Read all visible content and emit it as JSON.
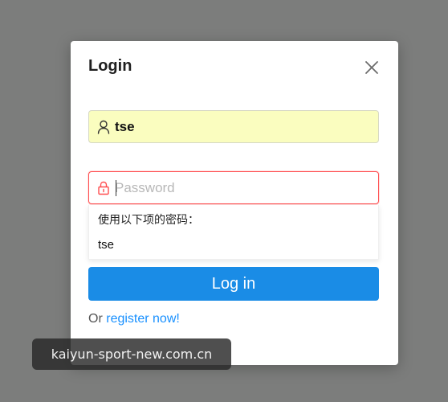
{
  "colors": {
    "backdrop": "#7c7d7c",
    "primary": "#1a8ce6",
    "error_border": "#ff4d4f",
    "autofill_bg": "#fafdbf",
    "link": "#1890ff"
  },
  "modal": {
    "title": "Login",
    "close_icon": "close-icon"
  },
  "form": {
    "username": {
      "icon": "user-icon",
      "value": "tse"
    },
    "password": {
      "icon": "lock-icon",
      "value": "",
      "placeholder": "Password",
      "state": "error"
    },
    "autofill_suggestion": {
      "header": "使用以下项的密码：",
      "items": [
        "tse"
      ]
    },
    "submit_label": "Log in",
    "register_prefix": "Or",
    "register_link": "register now!"
  },
  "watermark": {
    "text": "kaiyun-sport-new.com.cn"
  }
}
